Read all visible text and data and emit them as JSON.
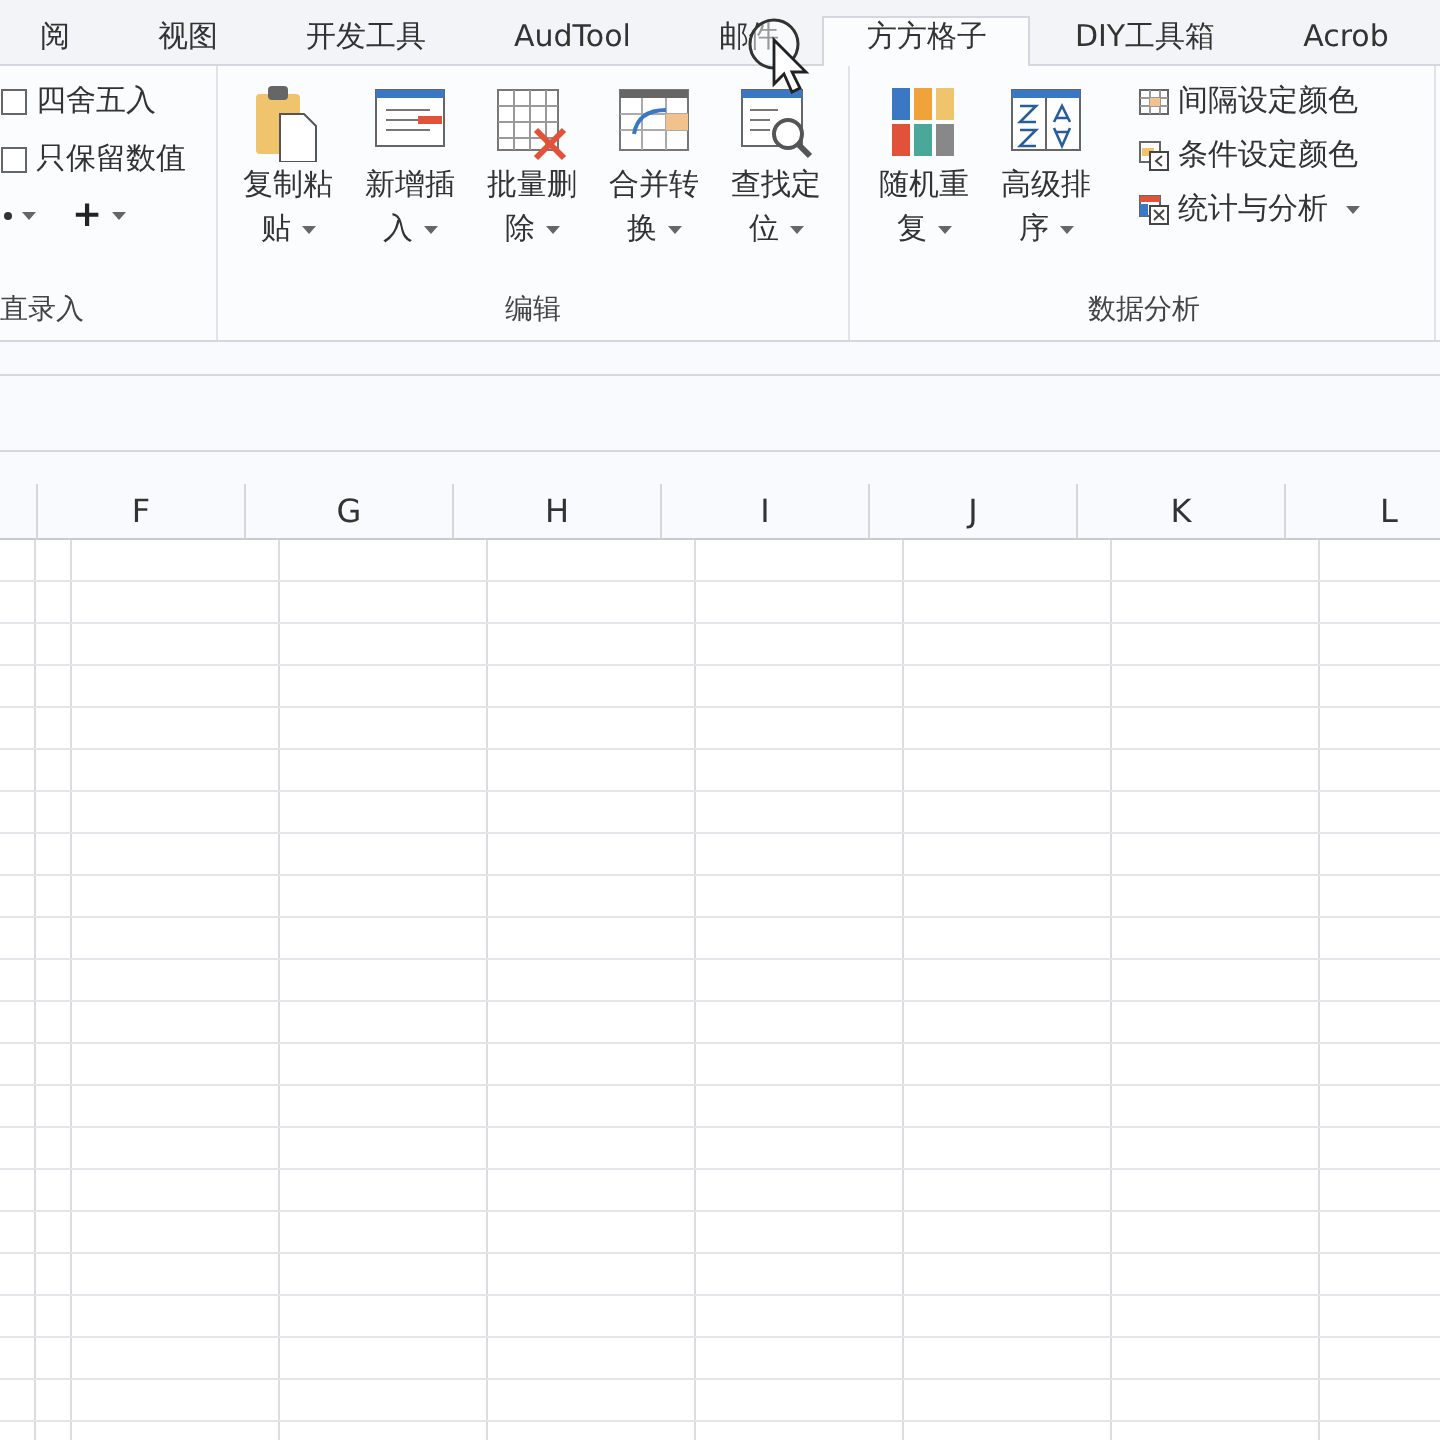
{
  "tabs": [
    {
      "label": "阅",
      "selected": false
    },
    {
      "label": "视图",
      "selected": false
    },
    {
      "label": "开发工具",
      "selected": false
    },
    {
      "label": "AudTool",
      "selected": false
    },
    {
      "label": "邮件",
      "selected": false
    },
    {
      "label": "方方格子",
      "selected": true
    },
    {
      "label": "DIY工具箱",
      "selected": false
    },
    {
      "label": "Acrob",
      "selected": false
    }
  ],
  "ribbon": {
    "groups": [
      {
        "label": "直录入",
        "items": [
          {
            "kind": "small",
            "label": "四舍五入"
          },
          {
            "kind": "small",
            "label": "只保留数值"
          },
          {
            "kind": "tools",
            "symbol": "+"
          }
        ]
      },
      {
        "label": "编辑",
        "items": [
          {
            "kind": "large",
            "label": "复制粘贴"
          },
          {
            "kind": "large",
            "label": "新增插入"
          },
          {
            "kind": "large",
            "label": "批量删除"
          },
          {
            "kind": "large",
            "label": "合并转换"
          },
          {
            "kind": "large",
            "label": "查找定位"
          }
        ]
      },
      {
        "label": "数据分析",
        "items": [
          {
            "kind": "large",
            "label": "随机重复"
          },
          {
            "kind": "large",
            "label": "高级排序"
          },
          {
            "kind": "stack",
            "items": [
              {
                "label": "间隔设定颜色",
                "dropdown": false
              },
              {
                "label": "条件设定颜色",
                "dropdown": false
              },
              {
                "label": "统计与分析",
                "dropdown": true
              }
            ]
          }
        ]
      }
    ]
  },
  "sheet": {
    "columns": [
      "F",
      "G",
      "H",
      "I",
      "J",
      "K",
      "L"
    ]
  }
}
